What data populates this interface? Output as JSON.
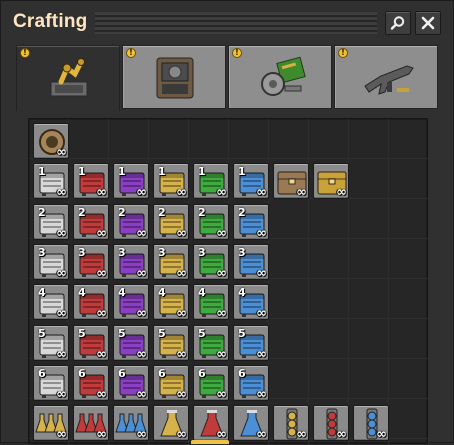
{
  "window": {
    "title": "Crafting"
  },
  "colors": {
    "accent_yellow": "#f2c231",
    "title_text": "#ffe6c0",
    "slot_gray": "#8b8b8b",
    "background": "#313031"
  },
  "tabs": [
    {
      "name": "logistics",
      "icon": "yellow-inserter-machine-icon",
      "selected": true,
      "warning": "!"
    },
    {
      "name": "production",
      "icon": "assembly-machine-icon",
      "selected": false,
      "warning": "!"
    },
    {
      "name": "intermediate",
      "icon": "gear-circuit-icon",
      "selected": false,
      "warning": "!"
    },
    {
      "name": "combat",
      "icon": "rifle-icon",
      "selected": false,
      "warning": "!"
    }
  ],
  "grid": {
    "infinity_label": "∞",
    "rows": [
      [
        {
          "icon": "pipe-icon",
          "color": "#b08a50",
          "tier": ""
        }
      ],
      [
        {
          "icon": "crate-icon",
          "color": "#d8d8d8",
          "tier": "1"
        },
        {
          "icon": "crate-icon",
          "color": "#c23b3b",
          "tier": "1"
        },
        {
          "icon": "crate-icon",
          "color": "#8b3fc4",
          "tier": "1"
        },
        {
          "icon": "crate-icon",
          "color": "#d6b24a",
          "tier": "1"
        },
        {
          "icon": "crate-icon",
          "color": "#3faa3f",
          "tier": "1"
        },
        {
          "icon": "crate-icon",
          "color": "#4b8fd6",
          "tier": "1"
        },
        {
          "icon": "wooden-chest-icon",
          "color": "#9a7a55",
          "tier": ""
        },
        {
          "icon": "golden-chest-icon",
          "color": "#caa23a",
          "tier": ""
        }
      ],
      [
        {
          "icon": "crate-icon",
          "color": "#d8d8d8",
          "tier": "2"
        },
        {
          "icon": "crate-icon",
          "color": "#c23b3b",
          "tier": "2"
        },
        {
          "icon": "crate-icon",
          "color": "#8b3fc4",
          "tier": "2"
        },
        {
          "icon": "crate-icon",
          "color": "#d6b24a",
          "tier": "2"
        },
        {
          "icon": "crate-icon",
          "color": "#3faa3f",
          "tier": "2"
        },
        {
          "icon": "crate-icon",
          "color": "#4b8fd6",
          "tier": "2"
        }
      ],
      [
        {
          "icon": "crate-icon",
          "color": "#d8d8d8",
          "tier": "3"
        },
        {
          "icon": "crate-icon",
          "color": "#c23b3b",
          "tier": "3"
        },
        {
          "icon": "crate-icon",
          "color": "#8b3fc4",
          "tier": "3"
        },
        {
          "icon": "crate-icon",
          "color": "#d6b24a",
          "tier": "3"
        },
        {
          "icon": "crate-icon",
          "color": "#3faa3f",
          "tier": "3"
        },
        {
          "icon": "crate-icon",
          "color": "#4b8fd6",
          "tier": "3"
        }
      ],
      [
        {
          "icon": "crate-icon",
          "color": "#d8d8d8",
          "tier": "4"
        },
        {
          "icon": "crate-icon",
          "color": "#c23b3b",
          "tier": "4"
        },
        {
          "icon": "crate-icon",
          "color": "#8b3fc4",
          "tier": "4"
        },
        {
          "icon": "crate-icon",
          "color": "#d6b24a",
          "tier": "4"
        },
        {
          "icon": "crate-icon",
          "color": "#3faa3f",
          "tier": "4"
        },
        {
          "icon": "crate-icon",
          "color": "#4b8fd6",
          "tier": "4"
        }
      ],
      [
        {
          "icon": "crate-icon",
          "color": "#d8d8d8",
          "tier": "5"
        },
        {
          "icon": "crate-icon",
          "color": "#c23b3b",
          "tier": "5"
        },
        {
          "icon": "crate-icon",
          "color": "#8b3fc4",
          "tier": "5"
        },
        {
          "icon": "crate-icon",
          "color": "#d6b24a",
          "tier": "5"
        },
        {
          "icon": "crate-icon",
          "color": "#3faa3f",
          "tier": "5"
        },
        {
          "icon": "crate-icon",
          "color": "#4b8fd6",
          "tier": "5"
        }
      ],
      [
        {
          "icon": "crate-icon",
          "color": "#d8d8d8",
          "tier": "6"
        },
        {
          "icon": "crate-icon",
          "color": "#c23b3b",
          "tier": "6"
        },
        {
          "icon": "crate-icon",
          "color": "#8b3fc4",
          "tier": "6"
        },
        {
          "icon": "crate-icon",
          "color": "#d6b24a",
          "tier": "6"
        },
        {
          "icon": "crate-icon",
          "color": "#3faa3f",
          "tier": "6"
        },
        {
          "icon": "crate-icon",
          "color": "#4b8fd6",
          "tier": "6"
        }
      ],
      [
        {
          "icon": "triple-flask-icon",
          "color": "#d6b24a",
          "tier": ""
        },
        {
          "icon": "triple-flask-icon",
          "color": "#c23b3b",
          "tier": ""
        },
        {
          "icon": "triple-flask-icon",
          "color": "#4b8fd6",
          "tier": ""
        },
        {
          "icon": "flask-icon",
          "color": "#d6b24a",
          "tier": ""
        },
        {
          "icon": "flask-icon",
          "color": "#c23b3b",
          "tier": ""
        },
        {
          "icon": "flask-icon",
          "color": "#4b8fd6",
          "tier": ""
        },
        {
          "icon": "chain-icon",
          "color": "#d6b24a",
          "tier": ""
        },
        {
          "icon": "chain-icon",
          "color": "#c23b3b",
          "tier": ""
        },
        {
          "icon": "chain-icon",
          "color": "#4b8fd6",
          "tier": ""
        }
      ]
    ]
  }
}
